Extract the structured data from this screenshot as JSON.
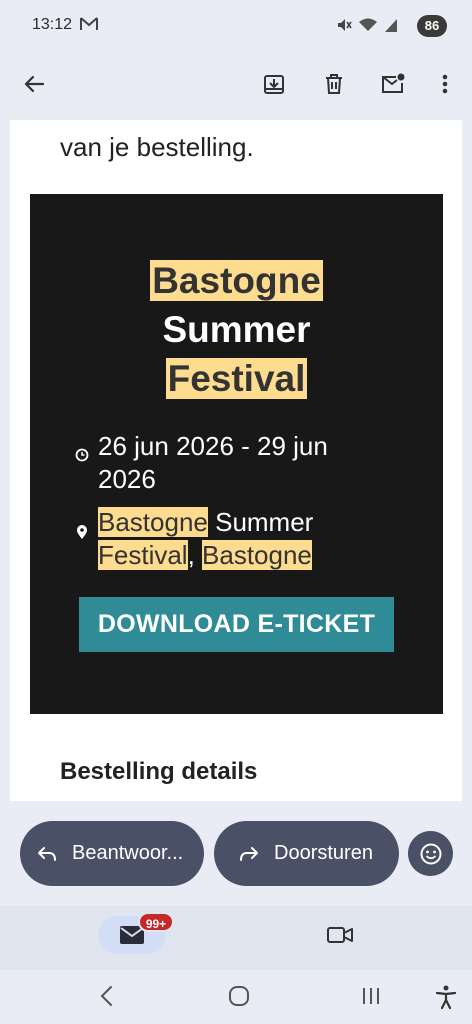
{
  "status_bar": {
    "time": "13:12",
    "battery": "86"
  },
  "toolbar": {
    "back_icon": "arrow-left-icon",
    "archive_icon": "archive-icon",
    "delete_icon": "trash-icon",
    "mark_unread_icon": "mail-unread-icon",
    "more_icon": "more-vert-icon"
  },
  "email": {
    "intro_text": "van je bestelling.",
    "event": {
      "title_lines": [
        "Bastogne",
        "Summer",
        "Festival"
      ],
      "date_text": "26 jun 2026 - 29 jun 2026",
      "location_part1": "Bastogne",
      "location_part2": " Summer",
      "location_part3": "Festival",
      "location_part4": ", ",
      "location_part5": "Bastogne",
      "download_button": "DOWNLOAD E-TICKET"
    },
    "details_heading": "Bestelling details"
  },
  "quick_actions": {
    "reply_label": "Beantwoor...",
    "forward_label": "Doorsturen"
  },
  "bottom_nav": {
    "mail_badge": "99+"
  },
  "colors": {
    "card_bg": "#181818",
    "highlight": "#fddc8f",
    "download_button": "#2f8c96",
    "pill_bg": "#4a5066",
    "badge": "#c62828"
  }
}
